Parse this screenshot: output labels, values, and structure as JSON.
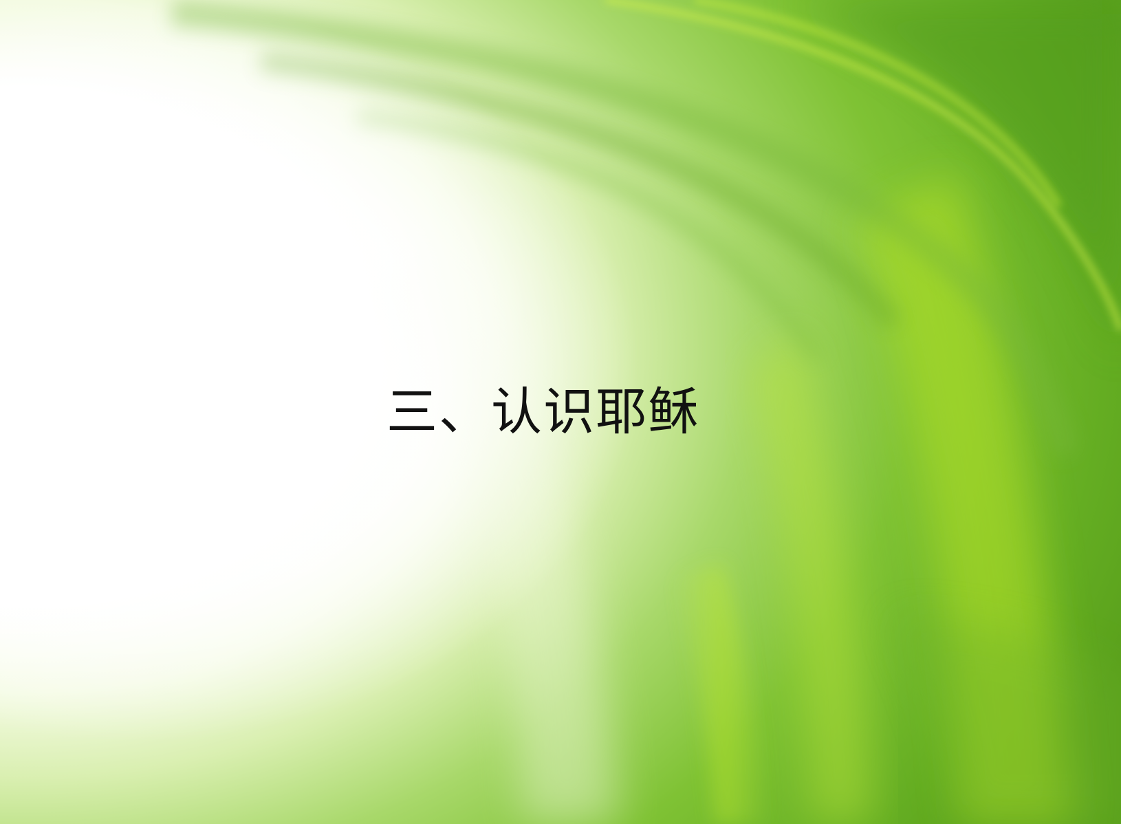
{
  "slide": {
    "title": "三、认识耶稣",
    "background_theme": "green-swoosh",
    "colors": {
      "light": "#ffffff",
      "pale_green": "#e6f5c4",
      "mid_green": "#8ccc38",
      "bright_green": "#b4e21e",
      "deep_green": "#5aa520",
      "text": "#111111"
    }
  }
}
